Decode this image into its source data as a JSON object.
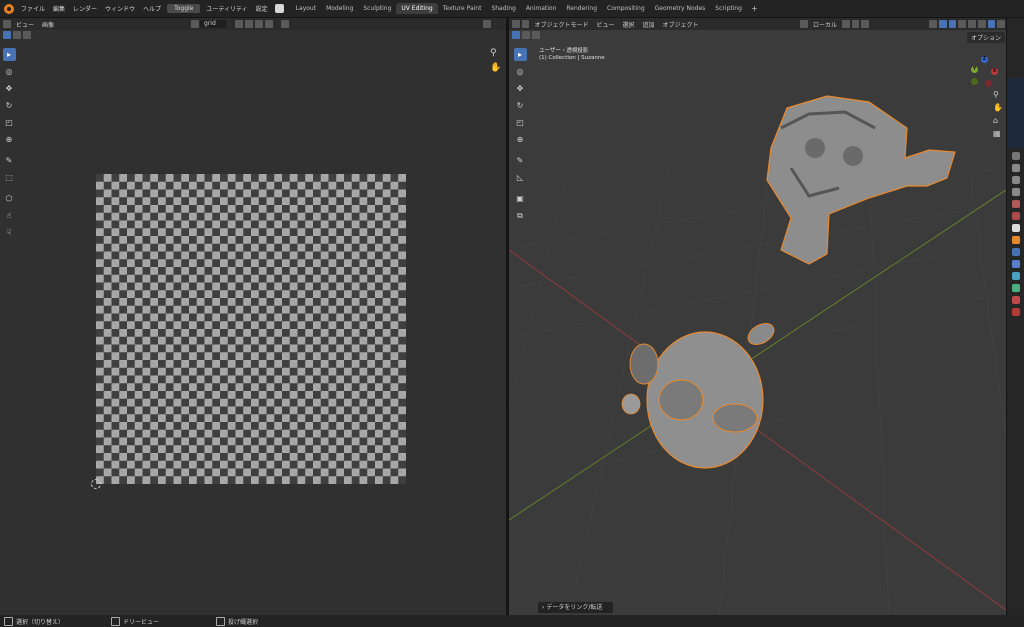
{
  "topbar": {
    "menu": [
      "ファイル",
      "編集",
      "レンダー",
      "ウィンドウ",
      "ヘルプ"
    ],
    "toggle_label": "Toggle",
    "menu_extra": [
      "ユーティリティ",
      "設定"
    ],
    "workspace_tabs": [
      "Layout",
      "Modeling",
      "Sculpting",
      "UV Editing",
      "Texture Paint",
      "Shading",
      "Animation",
      "Rendering",
      "Compositing",
      "Geometry Nodes",
      "Scripting"
    ],
    "active_tab": "UV Editing",
    "add_tab": "+"
  },
  "uv_editor": {
    "header_menu": [
      "ビュー",
      "画像"
    ],
    "image_name": "grid"
  },
  "viewport": {
    "mode": "オブジェクトモード",
    "header_menu": [
      "ビュー",
      "選択",
      "追加",
      "オブジェクト"
    ],
    "transform_orientation": "ローカル",
    "options_label": "オプション",
    "view_name": "ユーザー・透視投影",
    "collection_info": "(1) Collection | Suzanne",
    "gizmo": {
      "x": "X",
      "y": "Y",
      "z": "Z"
    },
    "redo_panel": "データをリンク/転送"
  },
  "statusbar": {
    "items": [
      "選択（切り替え）",
      "ドリービュー",
      "投げ縄選択"
    ]
  },
  "colors": {
    "accent": "#4772b3",
    "selection_outline": "#e8892e",
    "axis_x": "#c0393f",
    "axis_y": "#7ea82a"
  }
}
